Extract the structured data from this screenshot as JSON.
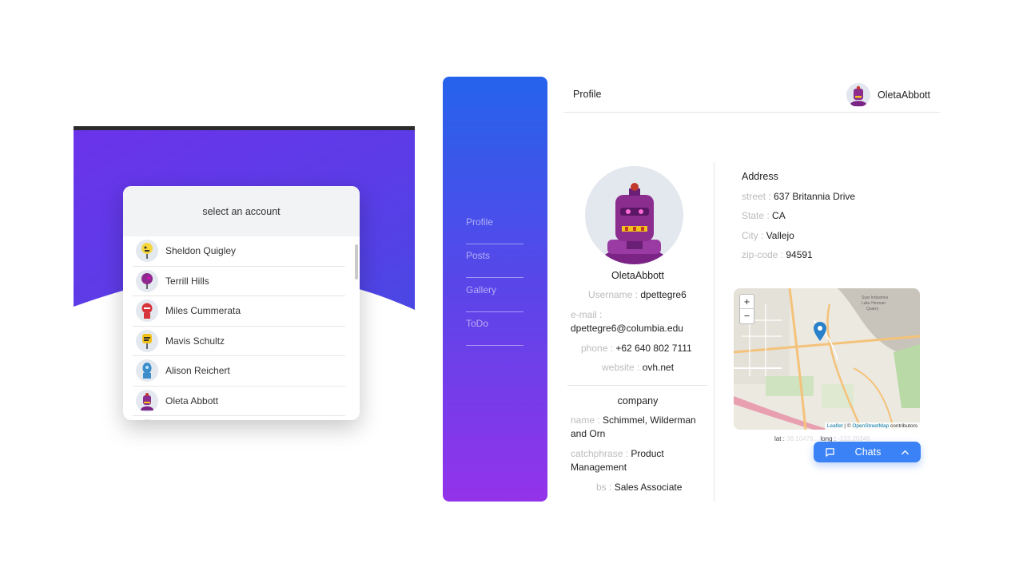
{
  "account_selector": {
    "title": "select an account",
    "accounts": [
      {
        "name": "Sheldon Quigley",
        "color": "#f5d63d"
      },
      {
        "name": "Terrill Hills",
        "color": "#8e2a8e"
      },
      {
        "name": "Miles Cummerata",
        "color": "#d8343c"
      },
      {
        "name": "Mavis Schultz",
        "color": "#f2c21b"
      },
      {
        "name": "Alison Reichert",
        "color": "#3b8ec9"
      },
      {
        "name": "Oleta Abbott",
        "color": "#8b2c8f"
      }
    ]
  },
  "sidebar": {
    "items": [
      {
        "label": "Profile"
      },
      {
        "label": "Posts"
      },
      {
        "label": "Gallery"
      },
      {
        "label": "ToDo"
      }
    ]
  },
  "header": {
    "title": "Profile",
    "username": "OletaAbbott"
  },
  "profile": {
    "display_name": "OletaAbbott",
    "username_label": "Username : ",
    "username": "dpettegre6",
    "email_label": "e-mail : ",
    "email": "dpettegre6@columbia.edu",
    "phone_label": "phone : ",
    "phone": "+62 640 802 7111",
    "website_label": "website : ",
    "website": "ovh.net",
    "company_title": "company",
    "company_name_label": "name : ",
    "company_name": "Schimmel, Wilderman and Orn",
    "catchphrase_label": "catchphrase : ",
    "catchphrase": "Product Management",
    "bs_label": "bs : ",
    "bs": "Sales Associate"
  },
  "address": {
    "title": "Address",
    "street_label": "street : ",
    "street": "637 Britannia Drive",
    "state_label": "State : ",
    "state": "CA",
    "city_label": "City : ",
    "city": "Vallejo",
    "zip_label": "zip-code : ",
    "zip": "94591"
  },
  "map": {
    "zoom_in": "+",
    "zoom_out": "−",
    "attribution_leaflet": "Leaflet",
    "attribution_sep": " | © ",
    "attribution_osm": "OpenStreetMap",
    "attribution_tail": " contributors",
    "label_quarry": "Syar Industries Lake Herman Quarry",
    "lat_label": "lat : ",
    "lat_value": "38.10476...",
    "long_label": "long : ",
    "long_value": "-122.20346"
  },
  "chats": {
    "label": "Chats"
  },
  "colors": {
    "sidebar_top": "#2563eb",
    "sidebar_bottom": "#9333ea",
    "chats_button": "#3b82f6"
  }
}
